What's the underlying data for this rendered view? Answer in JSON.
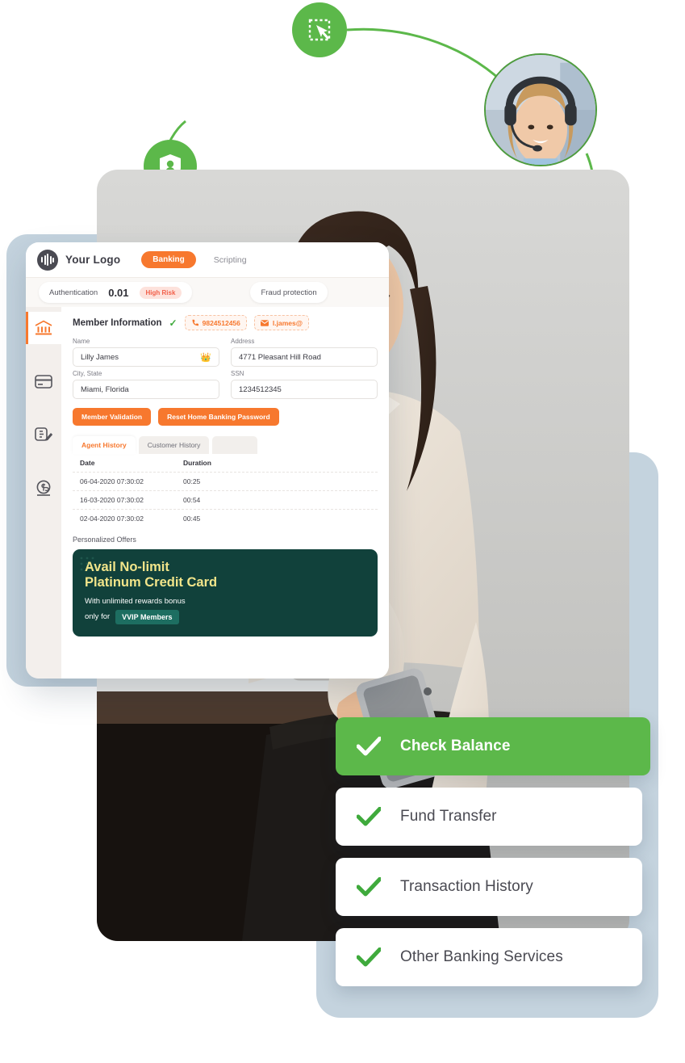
{
  "nodes": {
    "click_node_icon": "click-select-icon",
    "shield_node_icon": "shield-person-icon",
    "endpoint_icon": "endpoint-dot",
    "agent_photo_alt": "call-center-agent-photo"
  },
  "dashboard": {
    "logo_text": "Your Logo",
    "logo_icon": "soundwave-logo-icon",
    "nav": [
      {
        "label": "Banking",
        "active": true
      },
      {
        "label": "Scripting",
        "active": false
      }
    ],
    "status": {
      "auth_label": "Authentication",
      "auth_value": "0.01",
      "risk_badge": "High Risk",
      "fraud_label": "Fraud protection"
    },
    "sidebar": [
      {
        "icon": "bank-icon",
        "active": true
      },
      {
        "icon": "credit-card-icon",
        "active": false
      },
      {
        "icon": "invoice-edit-icon",
        "active": false
      },
      {
        "icon": "dollar-coin-icon",
        "active": false
      }
    ],
    "member": {
      "title": "Member Information",
      "verified_icon": "check-icon",
      "phone_icon": "phone-icon",
      "phone": "9824512456",
      "email_icon": "mail-icon",
      "email": "l.james@"
    },
    "fields": [
      {
        "label": "Name",
        "value": "Lilly James",
        "badge": "👑"
      },
      {
        "label": "Address",
        "value": "4771 Pleasant Hill Road",
        "badge": ""
      },
      {
        "label": "City, State",
        "value": "Miami, Florida",
        "badge": ""
      },
      {
        "label": "SSN",
        "value": "1234512345",
        "badge": ""
      }
    ],
    "buttons": [
      {
        "label": "Member Validation"
      },
      {
        "label": "Reset Home Banking Password"
      }
    ],
    "tabs": [
      {
        "label": "Agent History",
        "active": true
      },
      {
        "label": "Customer History",
        "active": false
      },
      {
        "label": "",
        "active": false
      }
    ],
    "table": {
      "columns": [
        "Date",
        "Duration"
      ],
      "rows": [
        [
          "06-04-2020 07:30:02",
          "00:25"
        ],
        [
          "16-03-2020 07:30:02",
          "00:54"
        ],
        [
          "02-04-2020 07:30:02",
          "00:45"
        ]
      ]
    },
    "offers": {
      "section_label": "Personalized Offers",
      "title_line1": "Avail No-limit",
      "title_line2": "Platinum Credit Card",
      "subtitle": "With unlimited rewards bonus",
      "only_for": "only for",
      "tag": "VVIP Members"
    }
  },
  "services": {
    "items": [
      {
        "label": "Check Balance",
        "icon": "check-icon",
        "primary": true
      },
      {
        "label": "Fund Transfer",
        "icon": "check-icon",
        "primary": false
      },
      {
        "label": "Transaction History",
        "icon": "check-icon",
        "primary": false
      },
      {
        "label": "Other Banking Services",
        "icon": "check-icon",
        "primary": false
      }
    ]
  },
  "colors": {
    "green": "#5cb84a",
    "orange": "#f7782e",
    "dark_teal": "#11413b",
    "backdrop_blue": "#c4d3de",
    "risk_red": "#f2604a"
  }
}
